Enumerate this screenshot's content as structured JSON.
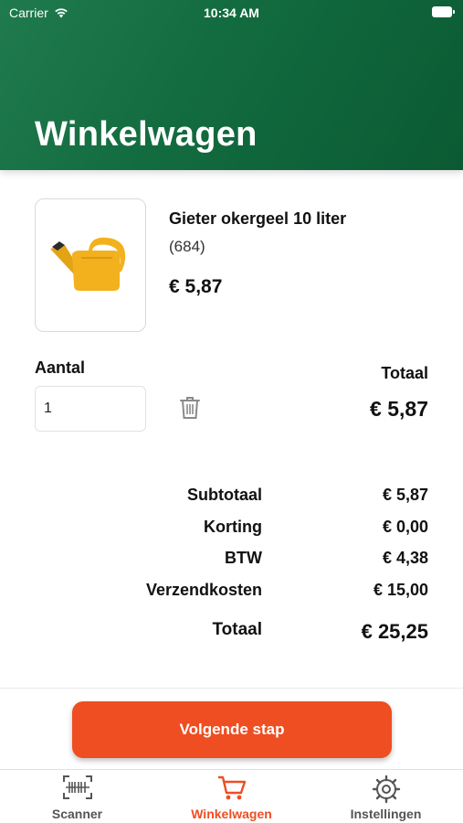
{
  "status_bar": {
    "carrier": "Carrier",
    "time": "10:34 AM"
  },
  "header": {
    "title": "Winkelwagen"
  },
  "cart_item": {
    "image_icon": "watering-can-icon",
    "name": "Gieter okergeel 10 liter",
    "code": "(684)",
    "price": "€ 5,87",
    "quantity_label": "Aantal",
    "quantity_value": "1",
    "total_label": "Totaal",
    "total_value": "€ 5,87",
    "delete_icon": "trash-icon"
  },
  "summary": {
    "subtotal_label": "Subtotaal",
    "subtotal_value": "€ 5,87",
    "discount_label": "Korting",
    "discount_value": "€ 0,00",
    "vat_label": "BTW",
    "vat_value": "€ 4,38",
    "shipping_label": "Verzendkosten",
    "shipping_value": "€ 15,00",
    "grand_total_label": "Totaal",
    "grand_total_value": "€ 25,25"
  },
  "next_button": {
    "label": "Volgende stap"
  },
  "tabs": [
    {
      "label": "Scanner",
      "icon": "barcode-scanner-icon",
      "active": false
    },
    {
      "label": "Winkelwagen",
      "icon": "cart-icon",
      "active": true
    },
    {
      "label": "Instellingen",
      "icon": "gear-icon",
      "active": false
    }
  ],
  "colors": {
    "header_green": "#126b3f",
    "accent_orange": "#ee4e22",
    "product_yellow": "#f2b11d"
  }
}
